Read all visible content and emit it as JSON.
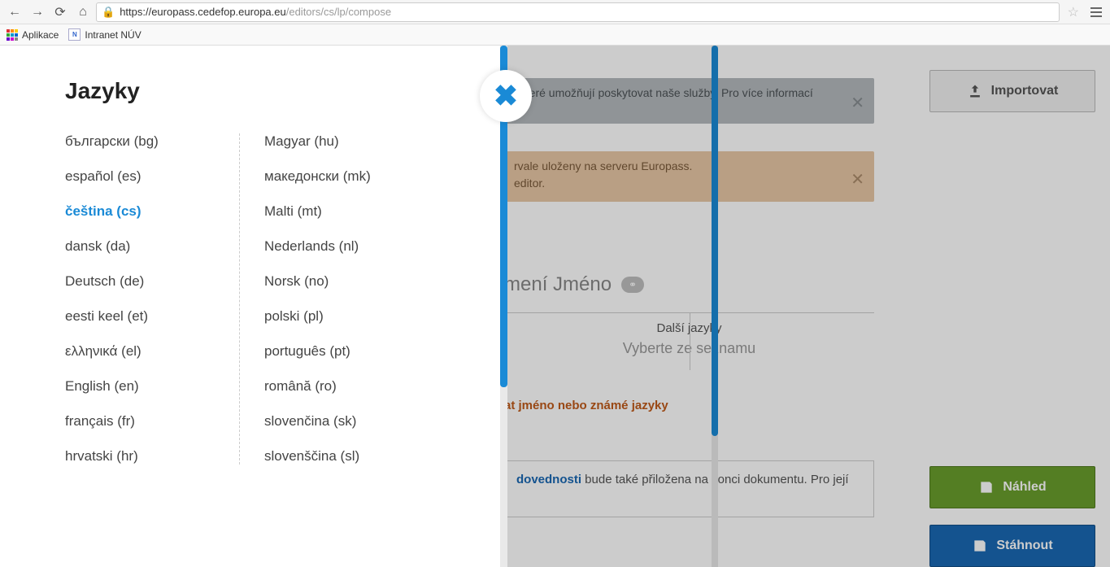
{
  "browser": {
    "url_dark": "https://europass.cedefop.europa.eu",
    "url_light": "/editors/cs/lp/compose",
    "bookmarks_apps": "Aplikace",
    "bookmark_1": "Intranet NÚV"
  },
  "modal": {
    "title": "Jazyky",
    "col1": [
      "български (bg)",
      "español (es)",
      "čeština (cs)",
      "dansk (da)",
      "Deutsch (de)",
      "eesti keel (et)",
      "ελληνικά (el)",
      "English (en)",
      "français (fr)",
      "hrvatski (hr)"
    ],
    "col2": [
      "Magyar (hu)",
      "македонски (mk)",
      "Malti (mt)",
      "Nederlands (nl)",
      "Norsk (no)",
      "polski (pl)",
      "português (pt)",
      "română (ro)",
      "slovenčina (sk)",
      "slovenščina (sl)"
    ],
    "active_index_col1": 2
  },
  "under": {
    "info_text": ", které umožňují poskytovat naše služby. Pro více informací",
    "warn_line1": "rvale uloženy na serveru Europass.",
    "warn_line2": "editor.",
    "name_placeholder": "mení Jméno",
    "lang_label": "Další jazyky",
    "lang_hint": "Vyberte ze seznamu",
    "must_msg": "at jméno nebo známé jazyky",
    "doc_kw": "dovednosti",
    "doc_rest": " bude také přiložena na konci dokumentu. Pro její"
  },
  "buttons": {
    "import": "Importovat",
    "preview": "Náhled",
    "download": "Stáhnout"
  }
}
